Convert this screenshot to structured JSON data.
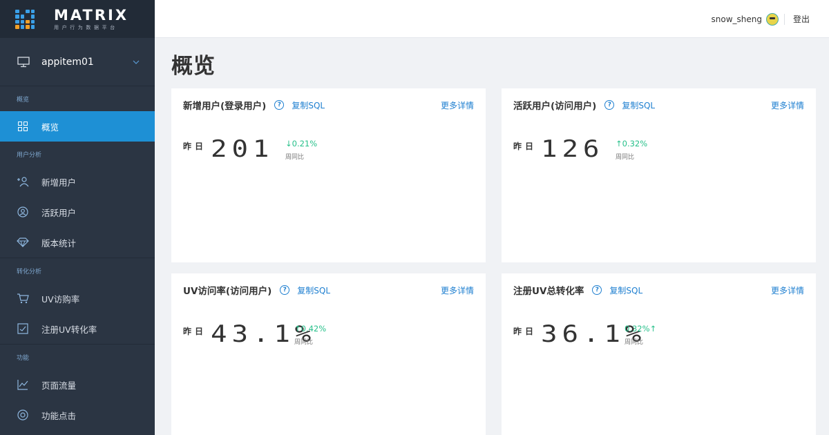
{
  "brand": {
    "name": "MATRIX",
    "subtitle": "用户行为数据平台"
  },
  "sidebar": {
    "app_name": "appitem01",
    "groups": [
      {
        "title": "概览",
        "items": [
          {
            "label": "概览",
            "icon": "grid-icon",
            "active": true
          }
        ]
      },
      {
        "title": "用户分析",
        "items": [
          {
            "label": "新增用户",
            "icon": "add-user-icon"
          },
          {
            "label": "活跃用户",
            "icon": "active-user-icon"
          },
          {
            "label": "版本统计",
            "icon": "diamond-icon"
          }
        ]
      },
      {
        "title": "转化分析",
        "items": [
          {
            "label": "UV访购率",
            "icon": "cart-icon"
          },
          {
            "label": "注册UV转化率",
            "icon": "checkbox-chart-icon"
          }
        ]
      },
      {
        "title": "功能",
        "items": [
          {
            "label": "页面流量",
            "icon": "line-chart-icon"
          },
          {
            "label": "功能点击",
            "icon": "click-icon"
          }
        ]
      }
    ]
  },
  "header": {
    "username": "snow_sheng",
    "logout": "登出"
  },
  "page": {
    "title": "概览"
  },
  "cards": [
    {
      "title": "新增用户(登录用户)",
      "copy": "复制SQL",
      "more": "更多详情",
      "label": "昨日",
      "value": "201",
      "delta": "↓0.21%",
      "delta_sub": "周同比"
    },
    {
      "title": "活跃用户(访问用户)",
      "copy": "复制SQL",
      "more": "更多详情",
      "label": "昨日",
      "value": "126",
      "delta": "↑0.32%",
      "delta_sub": "周同比"
    },
    {
      "title": "UV访问率(访问用户)",
      "copy": "复制SQL",
      "more": "更多详情",
      "label": "昨日",
      "value": "43.1%",
      "delta": "↑0.42%",
      "delta_sub": "周同比"
    },
    {
      "title": "注册UV总转化率",
      "copy": "复制SQL",
      "more": "更多详情",
      "label": "昨日",
      "value": "36.1%",
      "delta": "0.32%↑",
      "delta_sub": "周同比"
    }
  ],
  "colors": {
    "accent": "#1e90d5",
    "link": "#1e7fd0",
    "positive": "#27c08a",
    "sidebar_bg": "#2b3543"
  }
}
